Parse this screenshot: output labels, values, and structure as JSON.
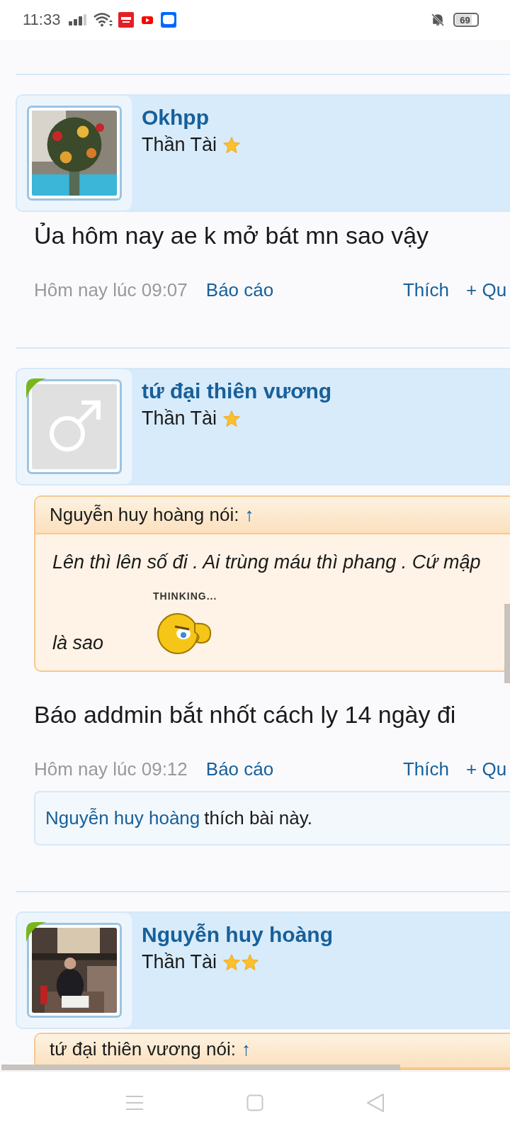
{
  "status_bar": {
    "time": "11:33",
    "battery": "69"
  },
  "posts": [
    {
      "author": "Okhpp",
      "rank": "Thần Tài",
      "stars": 1,
      "online": false,
      "message": "Ủa hôm nay ae k mở bát mn sao vậy",
      "date": "Hôm nay lúc 09:07",
      "report": "Báo cáo",
      "like": "Thích",
      "quote_action": "+ Qu"
    },
    {
      "author": "tứ đại thiên vương",
      "rank": "Thần Tài",
      "stars": 1,
      "online": true,
      "avatar": {
        "kind": "default"
      },
      "quote": {
        "author": "Nguyễn huy hoàng nói:",
        "link": "↑",
        "lines": [
          "Lên thì lên số đi . Ai trùng máu thì phang . Cứ mập",
          "là sao"
        ],
        "emoticon_caption": "THINKING..."
      },
      "message": "Báo addmin bắt nhốt cách ly 14 ngày đi",
      "date": "Hôm nay lúc 09:12",
      "report": "Báo cáo",
      "like": "Thích",
      "quote_action": "+ Qu",
      "likes": {
        "user": "Nguyễn huy hoàng",
        "text": "thích bài này."
      }
    },
    {
      "author": "Nguyễn huy hoàng",
      "rank": "Thần Tài",
      "stars": 2,
      "online": true,
      "quote": {
        "author": "tứ đại thiên vương nói:",
        "link": "↑"
      }
    }
  ]
}
